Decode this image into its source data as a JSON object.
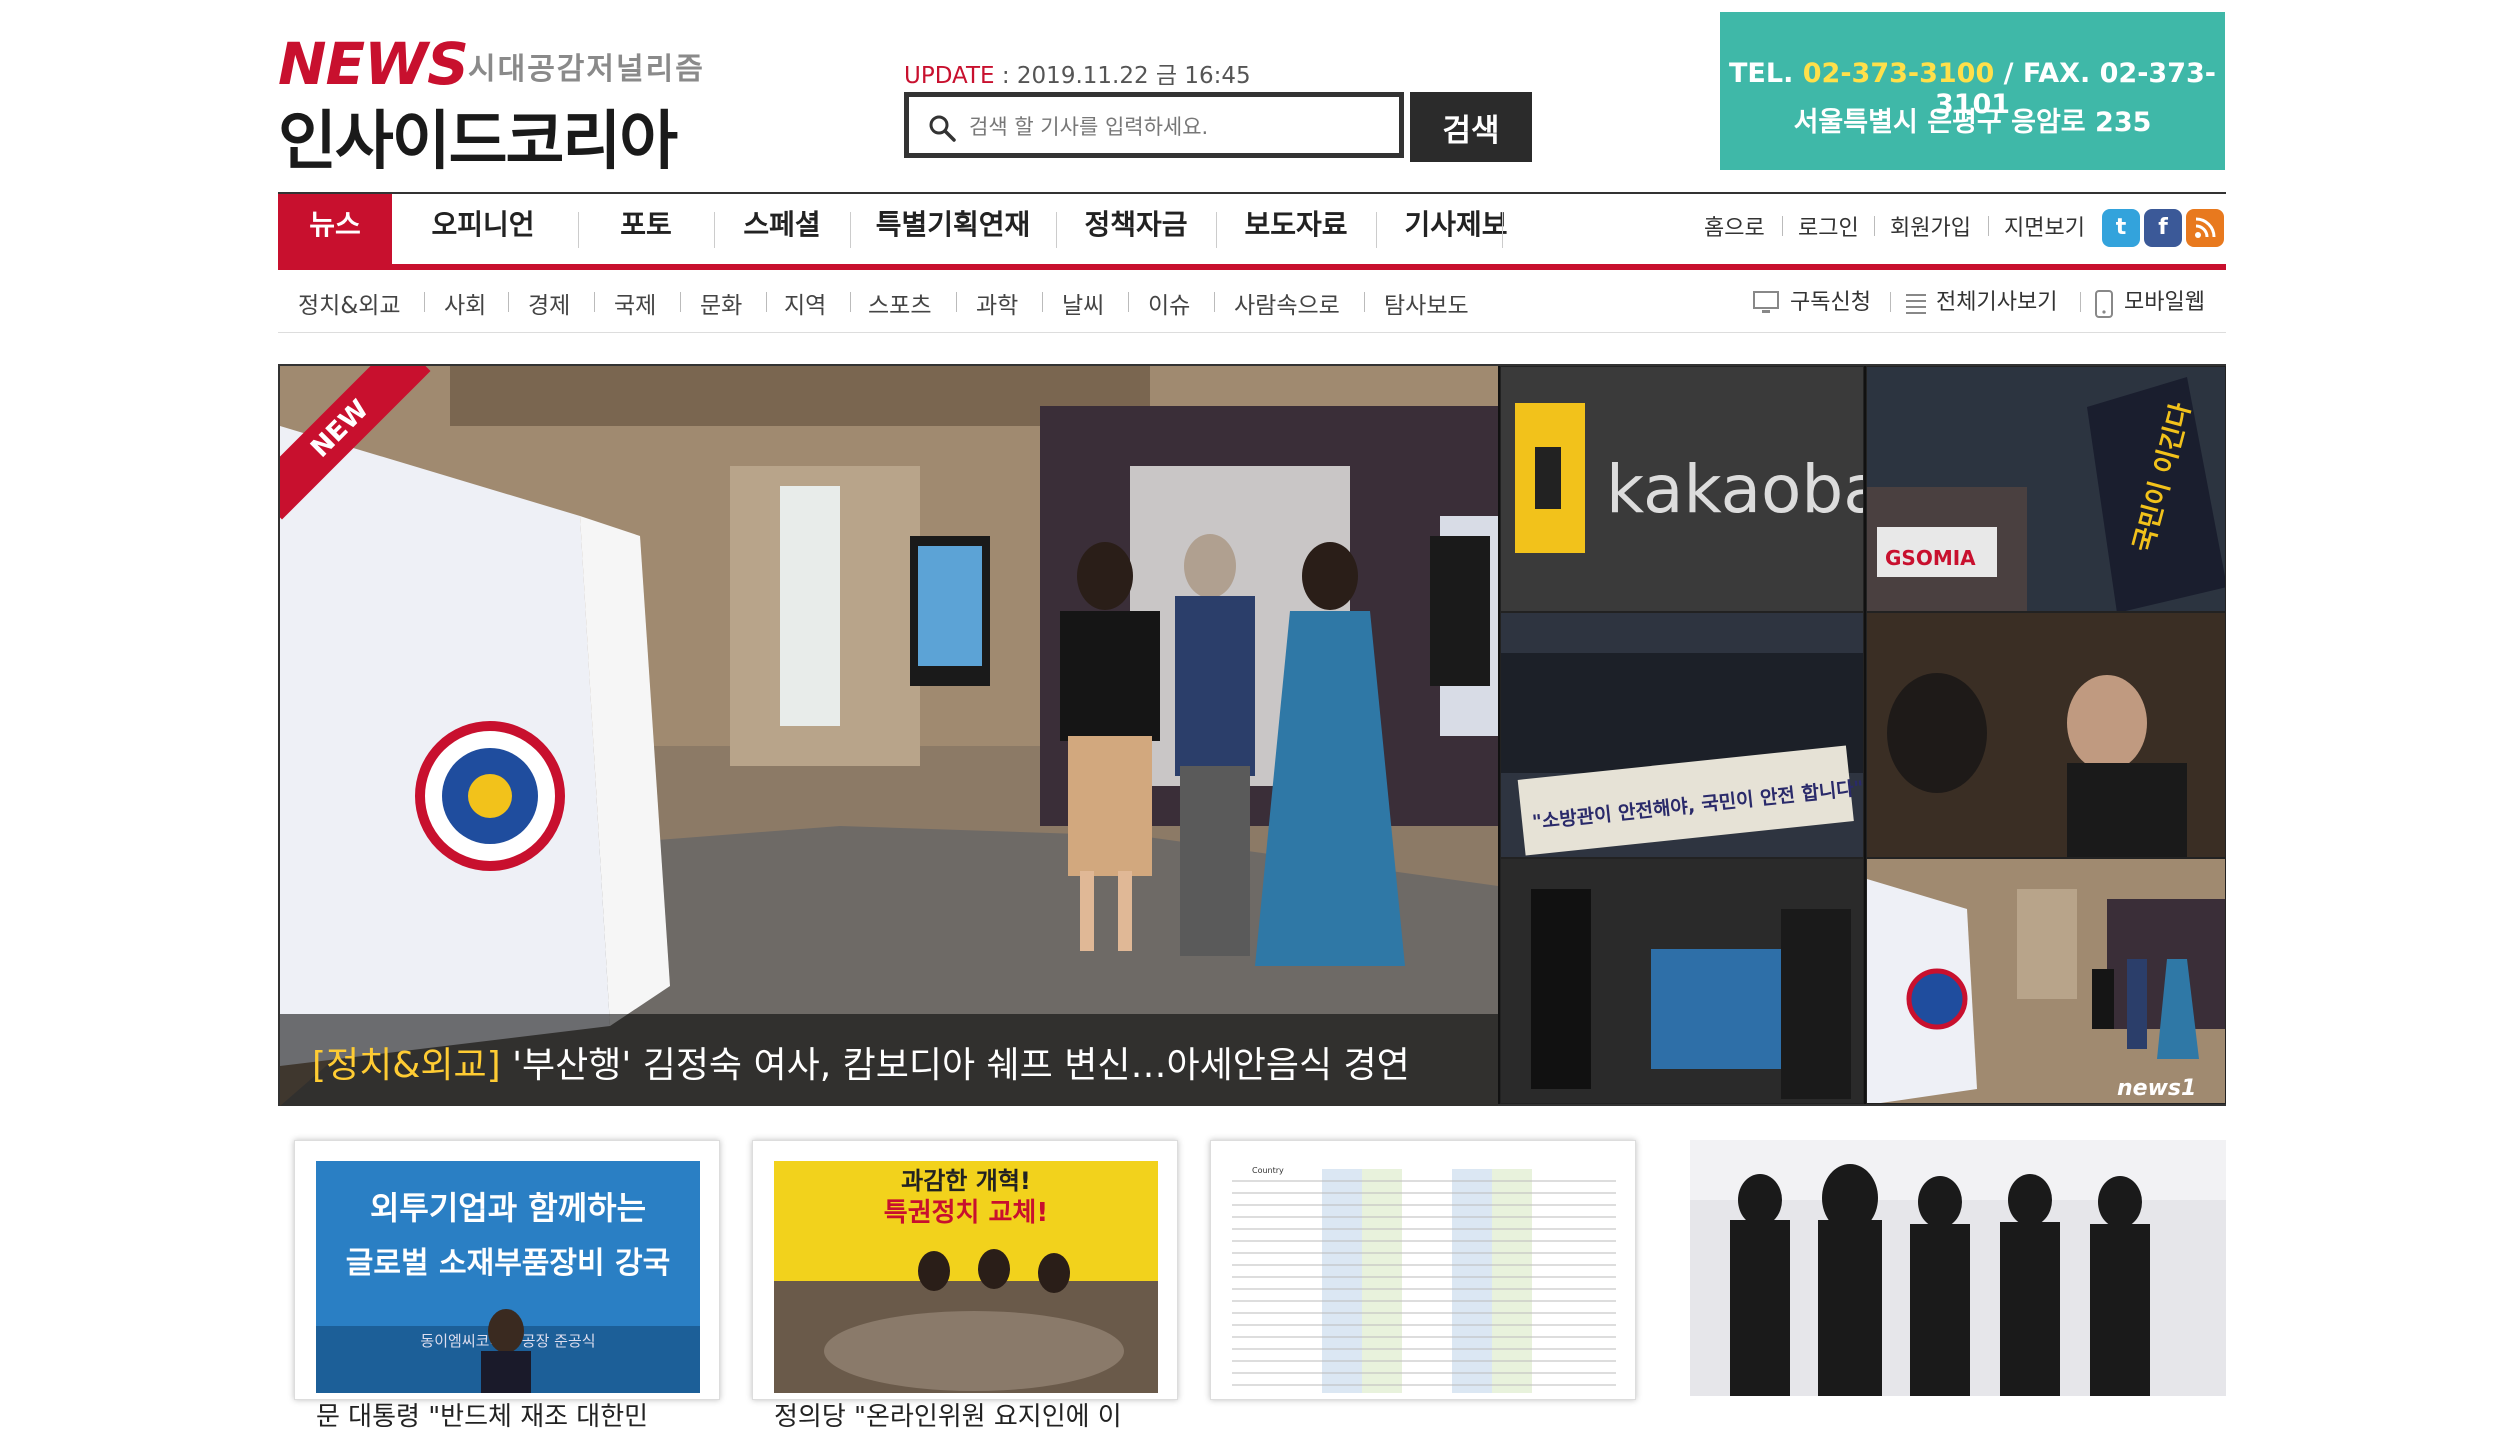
{
  "header": {
    "logo_news": "NEWS",
    "logo_slogan": "시대공감저널리즘",
    "logo_main": "인사이드코리아",
    "update_label": "UPDATE",
    "update_value": " : 2019.11.22 금 16:45",
    "search_placeholder": "검색 할 기사를 입력하세요.",
    "search_button": "검색",
    "contact_tel_label": "TEL. ",
    "contact_tel": "02-373-3100",
    "contact_fax": " / FAX. 02-373-3101",
    "contact_address": "서울특별시 은평구 응암로 235"
  },
  "nav": {
    "items": [
      "뉴스",
      "오피니언",
      "포토",
      "스페셜",
      "특별기획연재",
      "정책자금",
      "보도자료",
      "기사제보"
    ],
    "active": "뉴스",
    "util": [
      "홈으로",
      "로그인",
      "회원가입",
      "지면보기"
    ],
    "sns": [
      "twitter-icon",
      "facebook-icon",
      "rss-icon"
    ]
  },
  "subnav": {
    "items": [
      "정치&외교",
      "사회",
      "경제",
      "국제",
      "문화",
      "지역",
      "스포츠",
      "과학",
      "날씨",
      "이슈",
      "사람속으로",
      "탐사보도"
    ],
    "tools": [
      "구독신청",
      "전체기사보기",
      "모바일웹"
    ]
  },
  "hero": {
    "ribbon": "NEW",
    "category": "[정치&외교]",
    "title": " '부산행' 김정숙 여사, 캄보디아 쉐프 변신…아세안음식 경연",
    "thumbs": {
      "kakao": "kakaobank",
      "gsomia_sign": "GSOMIA",
      "protest_sign": "국민이 이긴다",
      "banner": "\"소방관이 안전해야, 국민이 안전 합니다\"",
      "watermark": "news1"
    }
  },
  "cards": [
    {
      "title": "문 대통령 \"반드체 재조 대한민",
      "img_text1": "외투기업과 함께하는",
      "img_text2": "글로벌 소재부품장비 강국",
      "img_caption": "동이엠씨코리아 공장 준공식"
    },
    {
      "title": "정의당 \"온라인위원 요지인에 이",
      "img_text1": "과감한 개혁!",
      "img_text2": "특권정치 교체!"
    },
    {
      "title": "",
      "img_text1": "Country"
    },
    {
      "title": ""
    }
  ]
}
